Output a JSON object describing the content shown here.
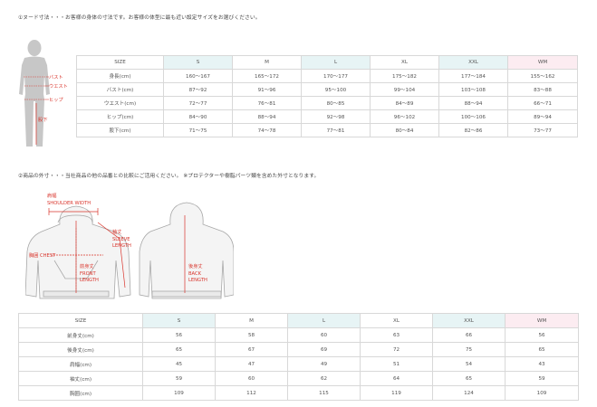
{
  "section1": {
    "heading": "①ヌード寸法・・・お客様の身体の寸法です。お客様の体型に最も近い設定サイズをお選びください。",
    "figure_labels": {
      "bust": "バスト",
      "waist": "ウエスト",
      "hip": "ヒップ",
      "inseam": "股下"
    },
    "table": {
      "columns": [
        "SIZE",
        "S",
        "M",
        "L",
        "XL",
        "XXL",
        "WM"
      ],
      "rows": [
        {
          "label": "身長(cm)",
          "values": [
            "160〜167",
            "165〜172",
            "170〜177",
            "175〜182",
            "177〜184",
            "155〜162"
          ]
        },
        {
          "label": "バスト(cm)",
          "values": [
            "87〜92",
            "91〜96",
            "95〜100",
            "99〜104",
            "103〜108",
            "83〜88"
          ]
        },
        {
          "label": "ウエスト(cm)",
          "values": [
            "72〜77",
            "76〜81",
            "80〜85",
            "84〜89",
            "88〜94",
            "66〜71"
          ]
        },
        {
          "label": "ヒップ(cm)",
          "values": [
            "84〜90",
            "88〜94",
            "92〜98",
            "96〜102",
            "100〜106",
            "89〜94"
          ]
        },
        {
          "label": "股下(cm)",
          "values": [
            "71〜75",
            "74〜78",
            "77〜81",
            "80〜84",
            "82〜86",
            "73〜77"
          ]
        }
      ]
    }
  },
  "section2": {
    "heading": "②商品の外寸・・・当社商品の他の品番との比較にご活用ください。 ※プロテクターや樹脂パーツ類を含めた外寸となります。",
    "figure_labels": {
      "shoulder_jp": "肩幅",
      "shoulder_en": "SHOULDER WIDTH",
      "sleeve_jp": "袖丈",
      "sleeve_en1": "SLEEVE",
      "sleeve_en2": "LENGTH",
      "chest": "胸囲 CHEST",
      "front_jp": "前身丈",
      "front_en1": "FRONT",
      "front_en2": "LENGTH",
      "back_jp": "後身丈",
      "back_en1": "BACK",
      "back_en2": "LENGTH"
    },
    "table": {
      "columns": [
        "SIZE",
        "S",
        "M",
        "L",
        "XL",
        "XXL",
        "WM"
      ],
      "rows": [
        {
          "label": "前身丈(cm)",
          "values": [
            "56",
            "58",
            "60",
            "63",
            "66",
            "56"
          ]
        },
        {
          "label": "後身丈(cm)",
          "values": [
            "65",
            "67",
            "69",
            "72",
            "75",
            "65"
          ]
        },
        {
          "label": "肩幅(cm)",
          "values": [
            "45",
            "47",
            "49",
            "51",
            "54",
            "43"
          ]
        },
        {
          "label": "袖丈(cm)",
          "values": [
            "59",
            "60",
            "62",
            "64",
            "65",
            "59"
          ]
        },
        {
          "label": "胸囲(cm)",
          "values": [
            "109",
            "112",
            "115",
            "119",
            "124",
            "109"
          ]
        }
      ]
    }
  },
  "colors": {
    "accent_red": "#d9342b",
    "header_cyan": "#e7f4f5",
    "header_pink": "#fcecf1",
    "silhouette_gray": "#c7c7c7"
  }
}
